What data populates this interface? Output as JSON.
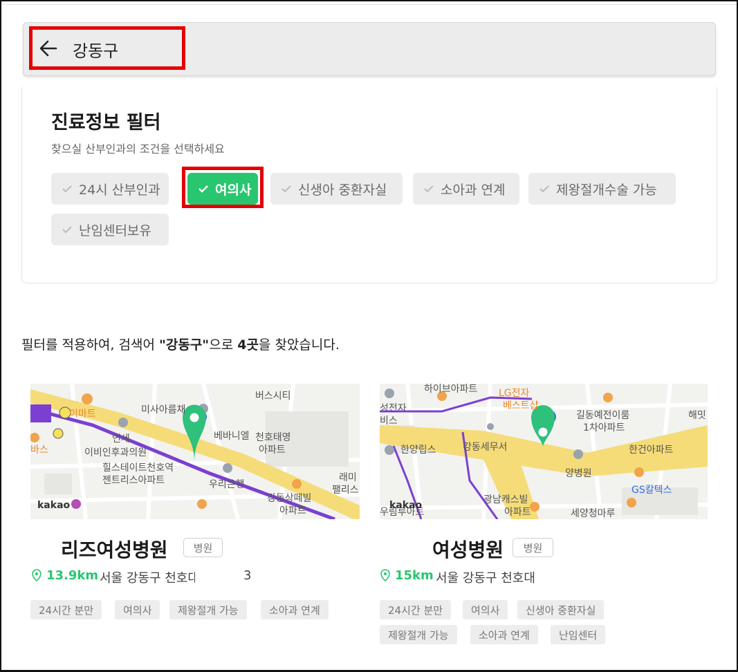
{
  "search": {
    "query": "강동구"
  },
  "filter": {
    "title": "진료정보 필터",
    "subtitle": "찾으실 산부인과의 조건을 선택하세요",
    "chips": [
      {
        "label": "24시 산부인과",
        "active": false
      },
      {
        "label": "여의사",
        "active": true
      },
      {
        "label": "신생아 중환자실",
        "active": false
      },
      {
        "label": "소아과 연계",
        "active": false
      },
      {
        "label": "제왕절개수술 가능",
        "active": false
      },
      {
        "label": "난임센터보유",
        "active": false
      }
    ]
  },
  "result": {
    "prefix": "필터를 적용하여, 검색어 ",
    "query_quoted": "\"강동구\"",
    "middle": "으로 ",
    "count": "4곳",
    "suffix": "을 찾았습니다."
  },
  "cards": [
    {
      "name": "리즈여성병원",
      "type": "병원",
      "distance": "13.9km",
      "address": "서울 강동구 천호대",
      "address_tail": "3",
      "tags": [
        "24시간 분만",
        "여의사",
        "제왕절개 가능",
        "소아과 연계"
      ],
      "map_labels": [
        "이마트",
        "미사아름채",
        "버스시티",
        "연세",
        "이비인후과의원",
        "베바니엘",
        "천호태영",
        "아파트",
        "힐스테이트천호역",
        "젠트리스아파트",
        "우리은행",
        "래미",
        "팰리스",
        "강동상떼빌",
        "아파트",
        "kakao",
        "바스"
      ]
    },
    {
      "name": "여성병원",
      "type": "병원",
      "distance": "15km",
      "address": "서울 강동구 천호대",
      "tags": [
        "24시간 분만",
        "여의사",
        "신생아 중환자실",
        "제왕절개 가능",
        "소아과 연계",
        "난임센터"
      ],
      "map_labels": [
        "하이브아파트",
        "LG전자",
        "베스트샵",
        "성전자",
        "비스",
        "길동예전이룸",
        "1차아파트",
        "해밋",
        "한양립스",
        "강동세무서",
        "한건아파트",
        "양병원",
        "GS칼텍스",
        "광남캐스빌",
        "아파트",
        "세양청마루",
        "우림루아트",
        "kakao"
      ]
    }
  ],
  "colors": {
    "accent": "#28c76f",
    "highlight": "#e30000",
    "road": "#f5dc78",
    "subway": "#7b3fd1"
  }
}
